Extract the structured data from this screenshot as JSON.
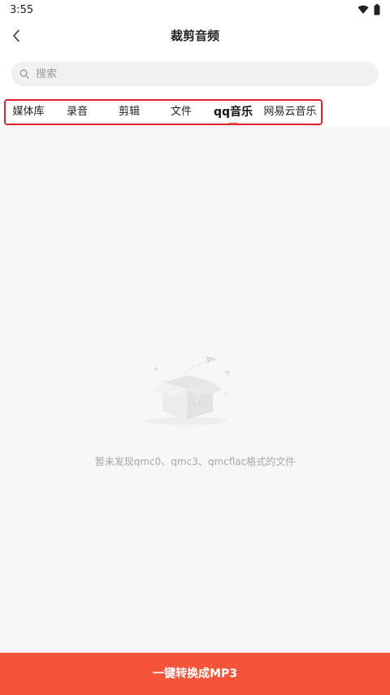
{
  "status_bar": {
    "time": "3:55"
  },
  "header": {
    "title": "裁剪音频"
  },
  "search": {
    "placeholder": "搜索",
    "value": ""
  },
  "tabs": [
    {
      "label": "媒体库"
    },
    {
      "label": "录音"
    },
    {
      "label": "剪辑"
    },
    {
      "label": "文件"
    },
    {
      "label": "qq音乐",
      "active": true
    },
    {
      "label": "网易云音乐"
    }
  ],
  "empty_state": {
    "message": "暂未发现qmc0、qmc3、qmcflac格式的文件"
  },
  "footer": {
    "convert_label": "一键转换成MP3"
  },
  "colors": {
    "accent": "#f4543a",
    "highlight_border": "#e01e2a"
  }
}
